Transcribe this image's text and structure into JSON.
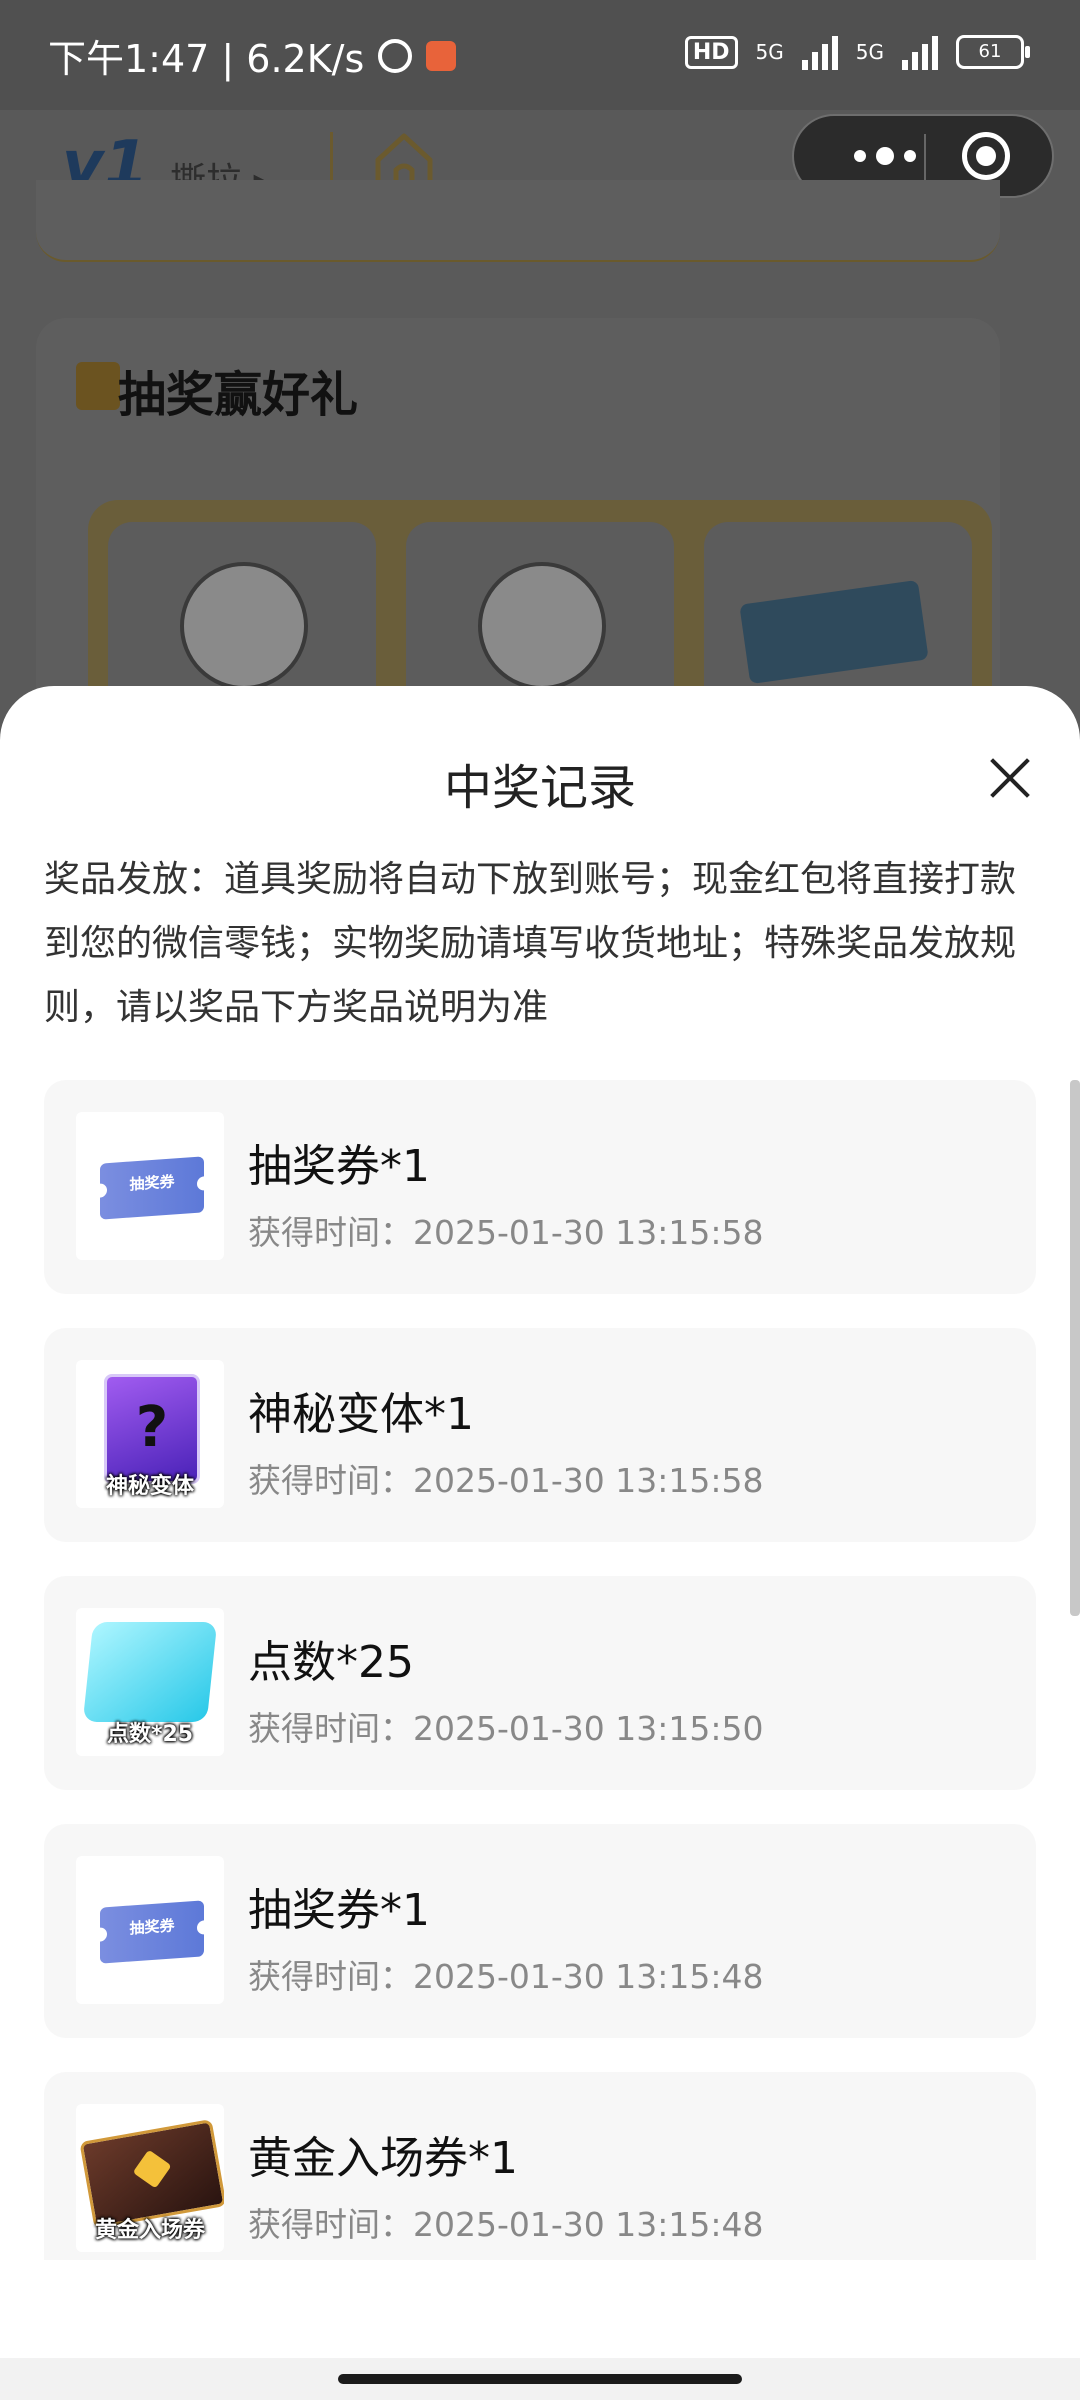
{
  "status_bar": {
    "time_speed": "下午1:47 | 6.2K/s",
    "hd_label": "HD",
    "net1": "5G",
    "net2": "5G",
    "battery": "61"
  },
  "nav": {
    "logo": "v1",
    "brand_name": "撕拉"
  },
  "background_page": {
    "section_title": "抽奖赢好礼"
  },
  "modal": {
    "title": "中奖记录",
    "notice": "奖品发放：道具奖励将自动下放到账号；现金红包将直接打款到您的微信零钱；实物奖励请填写收货地址；特殊奖品发放规则，请以奖品下方奖品说明为准",
    "records": [
      {
        "name": "抽奖券*1",
        "time": "获得时间：2025-01-30 13:15:58",
        "thumb_icon": "lottery-ticket-icon",
        "thumb_text": "抽奖券"
      },
      {
        "name": "神秘变体*1",
        "time": "获得时间：2025-01-30 13:15:58",
        "thumb_icon": "mystery-variant-icon",
        "thumb_text": "神秘变体"
      },
      {
        "name": "点数*25",
        "time": "获得时间：2025-01-30 13:15:50",
        "thumb_icon": "points-crystal-icon",
        "thumb_text": "点数*25"
      },
      {
        "name": "抽奖券*1",
        "time": "获得时间：2025-01-30 13:15:48",
        "thumb_icon": "lottery-ticket-icon",
        "thumb_text": "抽奖券"
      },
      {
        "name": "黄金入场券*1",
        "time": "获得时间：2025-01-30 13:15:48",
        "thumb_icon": "golden-ticket-icon",
        "thumb_text": "黄金入场券"
      }
    ]
  },
  "colors": {
    "overlay": "#5a5a5a",
    "modal_bg": "#ffffff",
    "card_bg": "#f7f7f7",
    "time_text": "#888888"
  }
}
